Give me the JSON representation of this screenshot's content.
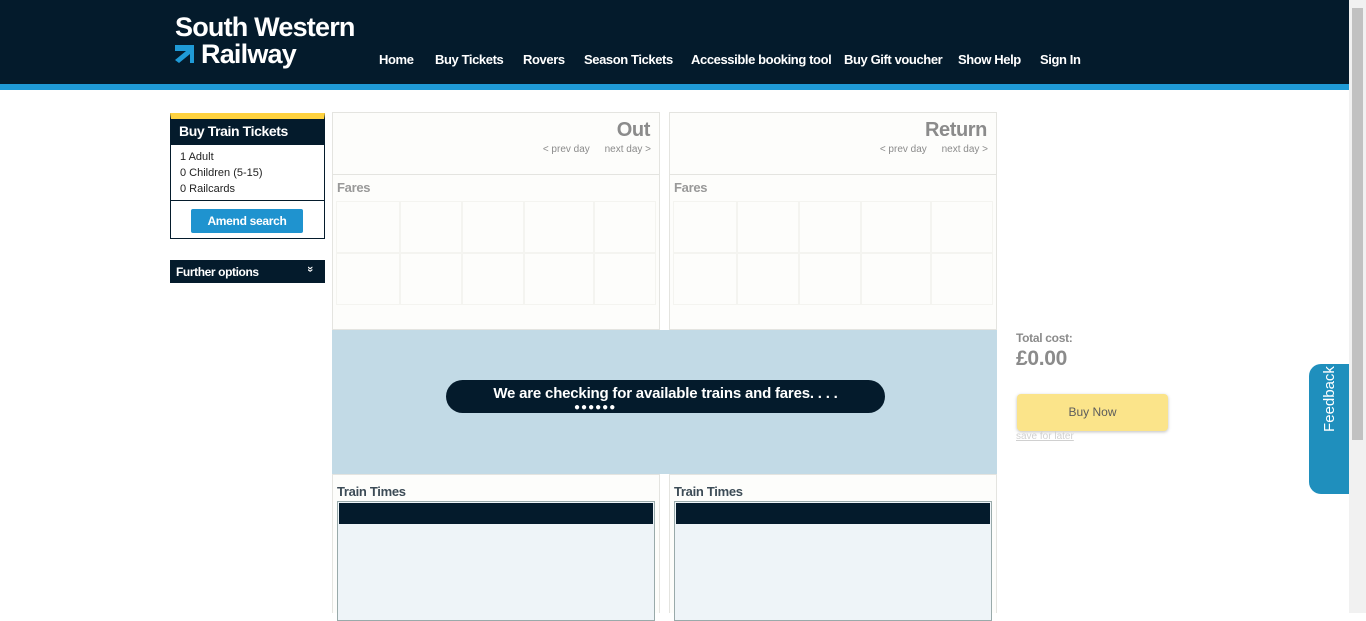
{
  "logo": {
    "line1": "South Western",
    "line2": "Railway"
  },
  "nav": [
    "Home",
    "Buy Tickets",
    "Rovers",
    "Season Tickets",
    "Accessible booking tool",
    "Buy Gift voucher",
    "Show Help",
    "Sign In"
  ],
  "sidebar": {
    "title": "Buy Train Tickets",
    "adults": "1 Adult",
    "children": "0 Children (5-15)",
    "railcards": "0 Railcards",
    "amend_label": "Amend search",
    "further_label": "Further options",
    "further_icon": "»"
  },
  "out": {
    "title": "Out",
    "prev": "< prev day",
    "next": "next day >",
    "fares": "Fares",
    "train_times": "Train Times"
  },
  "return": {
    "title": "Return",
    "prev": "< prev day",
    "next": "next day >",
    "fares": "Fares",
    "train_times": "Train Times"
  },
  "loading": {
    "message": "We are checking for available trains and fares. . . .",
    "dots": "●●●●●●"
  },
  "basket": {
    "total_label": "Total cost:",
    "total_value": "£0.00",
    "buy_label": "Buy Now",
    "save_label": "save for later"
  },
  "feedback": {
    "label": "Feedback"
  },
  "colors": {
    "navy": "#041b2c",
    "blue": "#1f9ad6",
    "yellow": "#ffd23f",
    "buy": "#fbe48a"
  }
}
